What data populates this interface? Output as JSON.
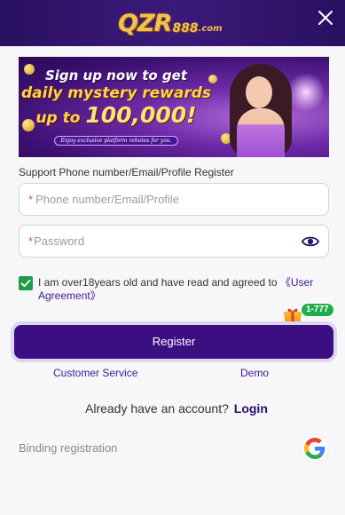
{
  "header": {
    "logo_main": "QZR",
    "logo_888": "888",
    "logo_com": ".com",
    "close_icon": "close-icon"
  },
  "banner": {
    "line1": "Sign up now to get",
    "line2": "daily mystery rewards",
    "line3_prefix": "up to ",
    "line3_amount": "100,000!",
    "subtitle": "Enjoy exclusive platform rebates for you."
  },
  "form": {
    "support_label": "Support Phone number/Email/Profile Register",
    "phone": {
      "required_mark": "*",
      "placeholder": "Phone number/Email/Profile",
      "value": ""
    },
    "password": {
      "required_mark": "*",
      "placeholder": "Password",
      "value": "",
      "toggle_icon": "eye-icon"
    },
    "agree": {
      "checked": true,
      "text": "I am over18years old and have read and agreed to ",
      "link": "《User Agreement》"
    },
    "gift_badge": "1-777",
    "register_label": "Register"
  },
  "links": {
    "customer_service": "Customer Service",
    "demo": "Demo"
  },
  "login": {
    "prompt": "Already have an account?",
    "link": "Login"
  },
  "binding": {
    "label": "Binding registration",
    "provider_icon": "google-icon"
  },
  "colors": {
    "header_bg": "#3b1a7a",
    "primary": "#3b0f82",
    "check_green": "#1e9e4a",
    "badge_green": "#1fae4a",
    "required_red": "#e05252"
  }
}
